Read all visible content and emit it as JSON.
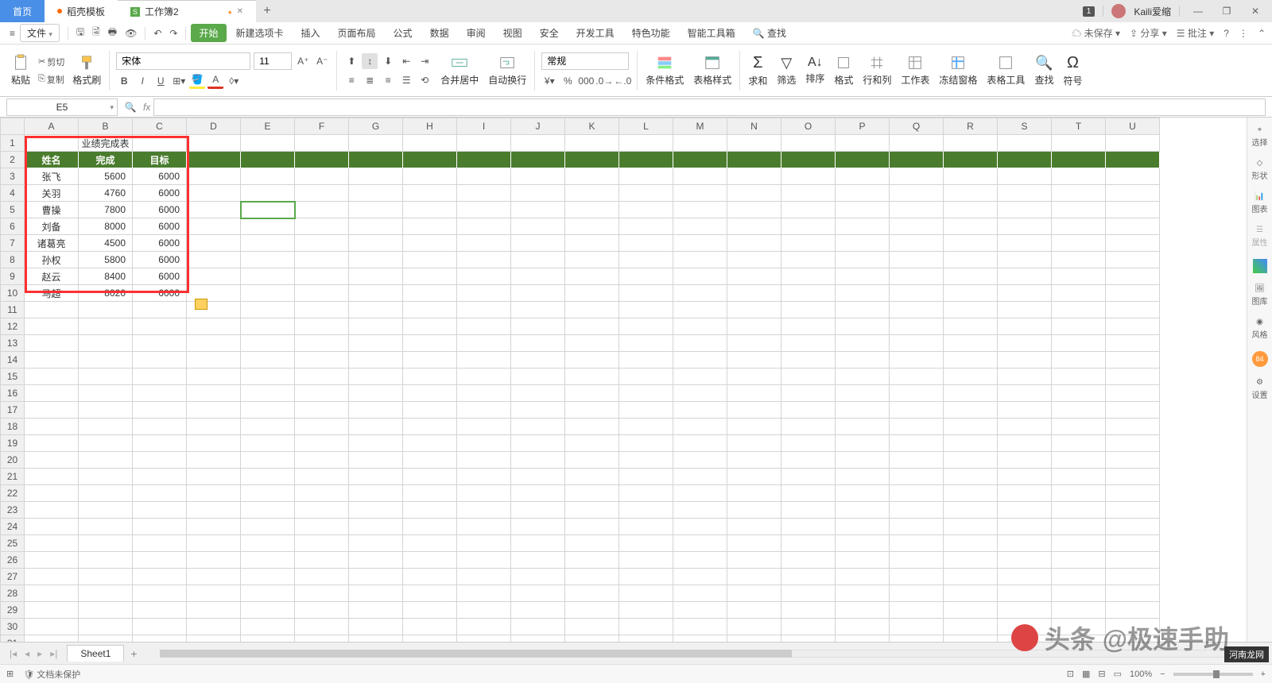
{
  "titlebar": {
    "tab_home": "首页",
    "tab_template": "稻壳模板",
    "tab_workbook": "工作簿2",
    "badge": "1",
    "username": "Kaili爱缩"
  },
  "menubar": {
    "file": "文件",
    "tabs": [
      "开始",
      "新建选项卡",
      "插入",
      "页面布局",
      "公式",
      "数据",
      "审阅",
      "视图",
      "安全",
      "开发工具",
      "特色功能",
      "智能工具箱"
    ],
    "search": "查找",
    "unsaved": "未保存",
    "share": "分享",
    "annotate": "批注"
  },
  "ribbon": {
    "paste": "粘贴",
    "cut": "剪切",
    "copy": "复制",
    "format_painter": "格式刷",
    "font_name": "宋体",
    "font_size": "11",
    "merge": "合并居中",
    "wrap": "自动换行",
    "number_format": "常规",
    "cond_format": "条件格式",
    "table_style": "表格样式",
    "sum": "求和",
    "filter": "筛选",
    "sort": "排序",
    "format": "格式",
    "row_col": "行和列",
    "worksheet": "工作表",
    "freeze": "冻结窗格",
    "table_tools": "表格工具",
    "find": "查找",
    "symbol": "符号"
  },
  "formula": {
    "namebox": "E5",
    "fx": "fx"
  },
  "sheet": {
    "cols": [
      "A",
      "B",
      "C",
      "D",
      "E",
      "F",
      "G",
      "H",
      "I",
      "J",
      "K",
      "L",
      "M",
      "N",
      "O",
      "P",
      "Q",
      "R",
      "S",
      "T",
      "U"
    ],
    "title": "业绩完成表",
    "headers": [
      "姓名",
      "完成",
      "目标"
    ],
    "rows": [
      {
        "name": "张飞",
        "done": "5600",
        "target": "6000"
      },
      {
        "name": "关羽",
        "done": "4760",
        "target": "6000"
      },
      {
        "name": "曹操",
        "done": "7800",
        "target": "6000"
      },
      {
        "name": "刘备",
        "done": "8000",
        "target": "6000"
      },
      {
        "name": "诸葛亮",
        "done": "4500",
        "target": "6000"
      },
      {
        "name": "孙权",
        "done": "5800",
        "target": "6000"
      },
      {
        "name": "赵云",
        "done": "8400",
        "target": "6000"
      },
      {
        "name": "马超",
        "done": "8020",
        "target": "6000"
      }
    ]
  },
  "sidepanel": {
    "select": "选择",
    "shape": "形状",
    "chart": "图表",
    "property": "属性",
    "gallery": "图库",
    "style": "风格",
    "settings": "设置"
  },
  "sheettabs": {
    "sheet1": "Sheet1"
  },
  "statusbar": {
    "protect": "文档未保护",
    "zoom": "100%"
  },
  "watermark": "头条 @极速手助",
  "corner_badge": "河南龙网"
}
